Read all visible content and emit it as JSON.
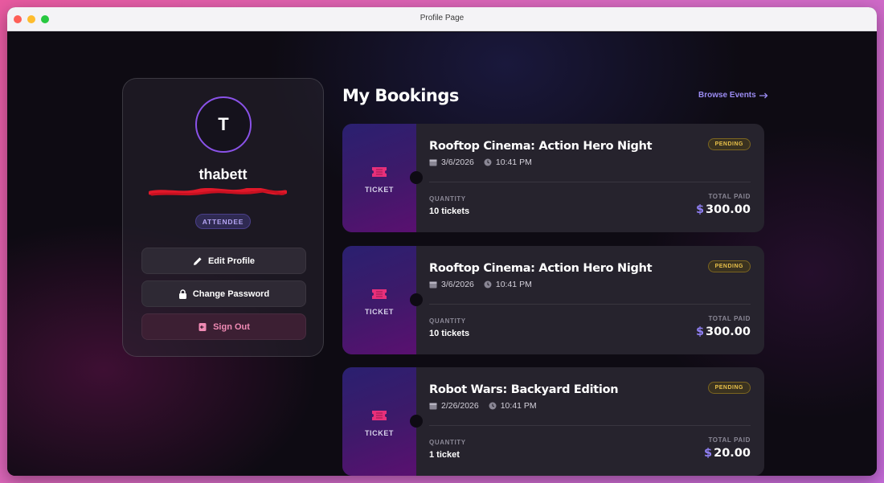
{
  "window": {
    "title": "Profile Page"
  },
  "profile": {
    "avatar_initial": "T",
    "username": "thabett",
    "role": "ATTENDEE",
    "buttons": {
      "edit": "Edit Profile",
      "password": "Change Password",
      "signout": "Sign Out"
    }
  },
  "bookings_section": {
    "heading": "My Bookings",
    "browse_link": "Browse Events"
  },
  "bookings": [
    {
      "stub_label": "TICKET",
      "title": "Rooftop Cinema: Action Hero Night",
      "status": "PENDING",
      "date": "3/6/2026",
      "time": "10:41 PM",
      "quantity_label": "QUANTITY",
      "quantity": "10 tickets",
      "paid_label": "TOTAL PAID",
      "currency": "$",
      "amount": "300.00"
    },
    {
      "stub_label": "TICKET",
      "title": "Rooftop Cinema: Action Hero Night",
      "status": "PENDING",
      "date": "3/6/2026",
      "time": "10:41 PM",
      "quantity_label": "QUANTITY",
      "quantity": "10 tickets",
      "paid_label": "TOTAL PAID",
      "currency": "$",
      "amount": "300.00"
    },
    {
      "stub_label": "TICKET",
      "title": "Robot Wars: Backyard Edition",
      "status": "PENDING",
      "date": "2/26/2026",
      "time": "10:41 PM",
      "quantity_label": "QUANTITY",
      "quantity": "1 ticket",
      "paid_label": "TOTAL PAID",
      "currency": "$",
      "amount": "20.00"
    }
  ],
  "colors": {
    "accent": "#8f7ff2",
    "ticket_pink": "#e8307a",
    "pending": "#e8c04a",
    "signout": "#f08ab4"
  }
}
